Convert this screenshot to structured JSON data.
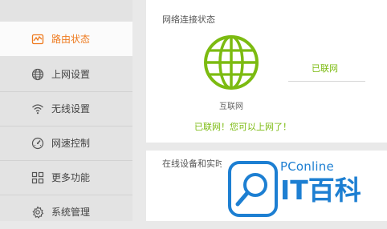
{
  "sidebar": {
    "items": [
      {
        "label": "路由状态",
        "icon": "pulse-chart-icon",
        "active": true
      },
      {
        "label": "上网设置",
        "icon": "globe-icon",
        "active": false
      },
      {
        "label": "无线设置",
        "icon": "wifi-icon",
        "active": false
      },
      {
        "label": "网速控制",
        "icon": "speedometer-icon",
        "active": false
      },
      {
        "label": "更多功能",
        "icon": "grid-icon",
        "active": false
      },
      {
        "label": "系统管理",
        "icon": "gear-icon",
        "active": false
      }
    ]
  },
  "network_status": {
    "title": "网络连接状态",
    "internet_label": "互联网",
    "connection_status": "已联网",
    "message": "已联网！您可以上网了！"
  },
  "devices": {
    "title": "在线设备和实时"
  },
  "watermark": {
    "brand": "PConline",
    "name": "IT百科"
  },
  "colors": {
    "accent_orange": "#ee7a1e",
    "status_green": "#7cbb11",
    "watermark_blue": "#1d7fd2"
  }
}
